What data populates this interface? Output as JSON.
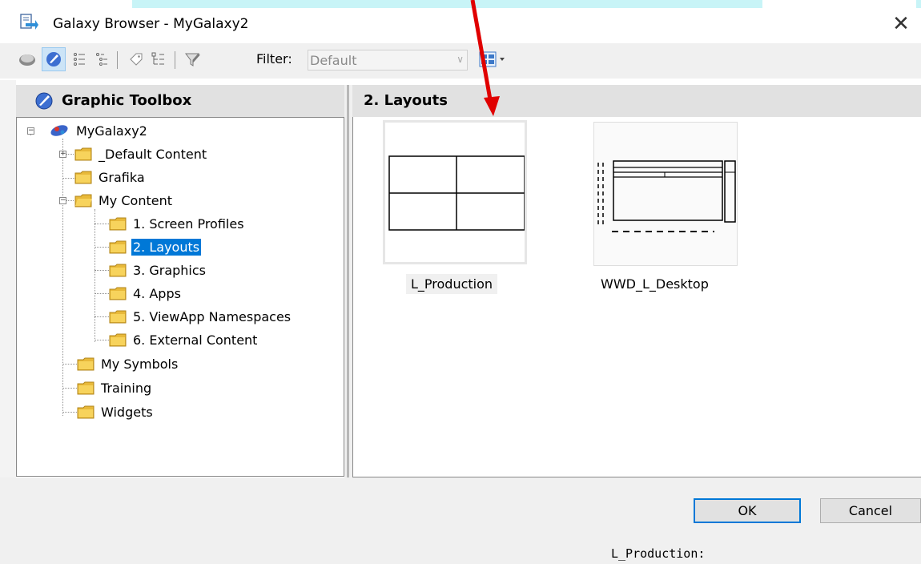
{
  "window": {
    "title": "Galaxy Browser - MyGalaxy2",
    "close_glyph": "✕"
  },
  "toolbar": {
    "filter_label": "Filter:",
    "filter_value": "Default",
    "icons": [
      "galaxy-icon",
      "graphic-toolbox-icon",
      "list-view-icon",
      "detail-view-icon",
      "tag-icon",
      "hierarchy-icon",
      "filter-icon",
      "view-options-icon"
    ]
  },
  "left_panel": {
    "header": "Graphic Toolbox",
    "tree": [
      {
        "label": "MyGalaxy2",
        "level": 0,
        "expander": "−"
      },
      {
        "label": "_Default Content",
        "level": 1,
        "expander": "+"
      },
      {
        "label": "Grafika",
        "level": 1
      },
      {
        "label": "My Content",
        "level": 1,
        "expander": "−"
      },
      {
        "label": "1. Screen Profiles",
        "level": 2
      },
      {
        "label": "2. Layouts",
        "level": 2,
        "selected": true
      },
      {
        "label": "3. Graphics",
        "level": 2
      },
      {
        "label": "4. Apps",
        "level": 2
      },
      {
        "label": "5. ViewApp Namespaces",
        "level": 2
      },
      {
        "label": "6. External Content",
        "level": 2
      },
      {
        "label": "My Symbols",
        "level": 1
      },
      {
        "label": "Training",
        "level": 1
      },
      {
        "label": "Widgets",
        "level": 1
      }
    ]
  },
  "right_panel": {
    "header": "2. Layouts",
    "items": [
      {
        "label": "L_Production",
        "selected": true
      },
      {
        "label": "WWD_L_Desktop",
        "selected": false
      }
    ]
  },
  "buttons": {
    "ok": "OK",
    "cancel": "Cancel"
  },
  "status": {
    "text": "L_Production:"
  },
  "colors": {
    "selection": "#0078d7",
    "annotation_arrow": "#e00000",
    "top_band": "#c8f4f7"
  }
}
